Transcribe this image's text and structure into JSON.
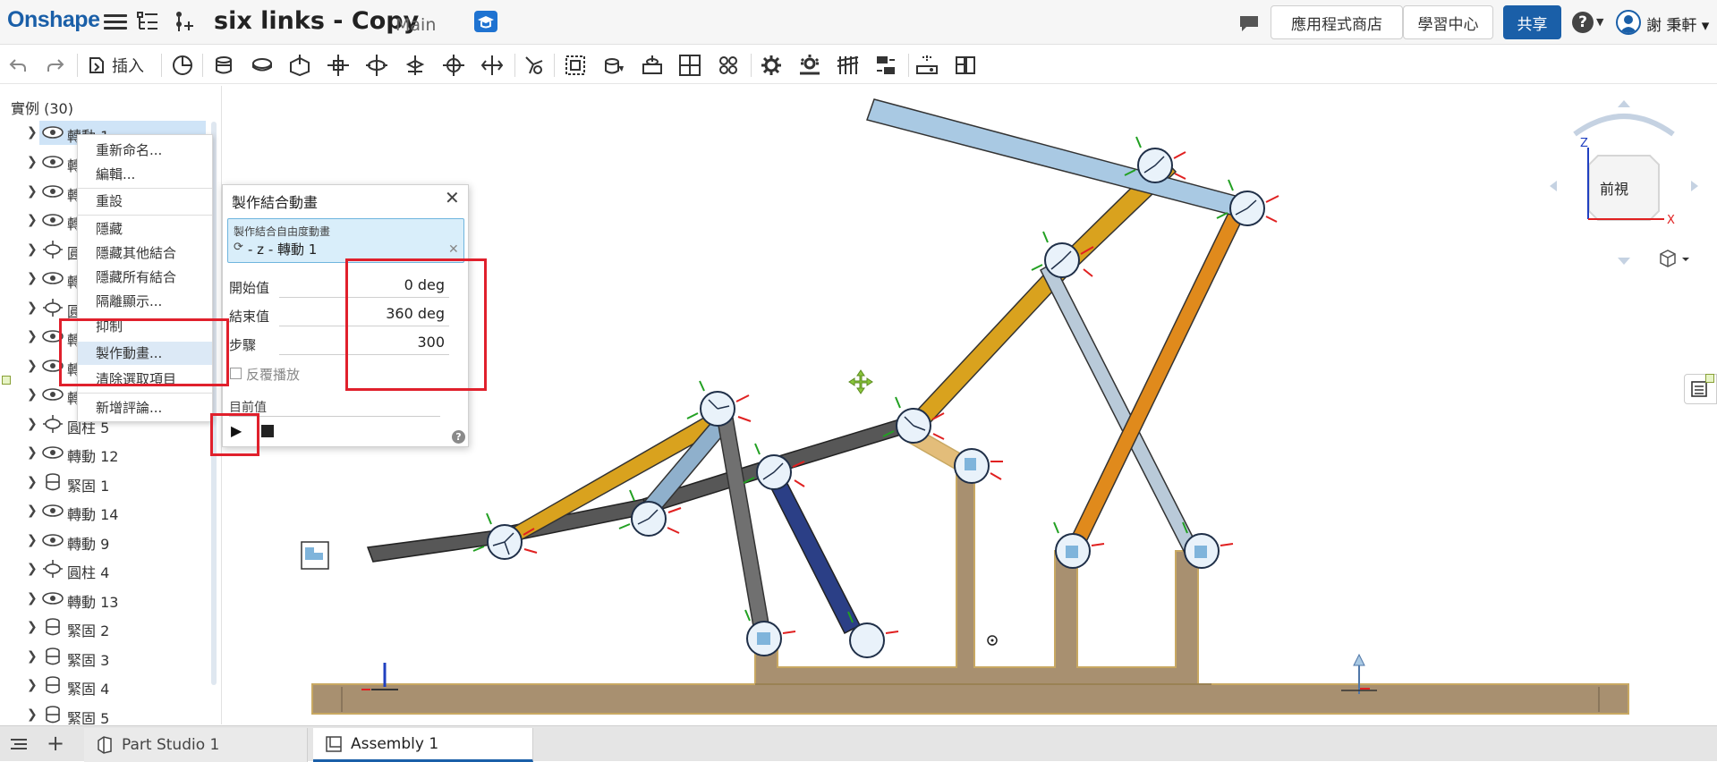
{
  "app": {
    "logo": "Onshape",
    "document_title": "six links - Copy",
    "branch": "Main",
    "app_store": "應用程式商店",
    "learning_center": "學習中心",
    "share": "共享",
    "help": "?",
    "username": "謝 秉軒"
  },
  "toolbar": {
    "insert_label": "插入",
    "icons": [
      "undo-icon",
      "redo-icon",
      "insert-icon",
      "mate-connector-icon",
      "fastened-mate-icon",
      "revolute-mate-icon",
      "slider-mate-icon",
      "planar-mate-icon",
      "cylindrical-mate-icon",
      "pin-slot-mate-icon",
      "ball-mate-icon",
      "parallel-mate-icon",
      "tangent-mate-icon",
      "group-icon",
      "replicate-icon",
      "mate-connector-2-icon",
      "relation-icon",
      "pattern-icon",
      "gear-relation-icon",
      "rack-pinion-icon",
      "screw-relation-icon",
      "linear-relation-icon",
      "explode-icon",
      "section-icon"
    ]
  },
  "instances": {
    "header": "實例 (30)",
    "items": [
      {
        "label": "轉動 1",
        "icon": "revolute-icon"
      },
      {
        "label": "轉",
        "icon": "revolute-icon"
      },
      {
        "label": "轉",
        "icon": "revolute-icon"
      },
      {
        "label": "轉",
        "icon": "revolute-icon"
      },
      {
        "label": "圓",
        "icon": "cylindrical-icon"
      },
      {
        "label": "轉",
        "icon": "revolute-icon"
      },
      {
        "label": "圓",
        "icon": "cylindrical-icon"
      },
      {
        "label": "轉",
        "icon": "revolute-icon"
      },
      {
        "label": "轉",
        "icon": "revolute-icon"
      },
      {
        "label": "轉",
        "icon": "revolute-icon"
      },
      {
        "label": "圓柱 5",
        "icon": "cylindrical-icon"
      },
      {
        "label": "轉動 12",
        "icon": "revolute-icon"
      },
      {
        "label": "緊固 1",
        "icon": "fastened-icon"
      },
      {
        "label": "轉動 14",
        "icon": "revolute-icon"
      },
      {
        "label": "轉動 9",
        "icon": "revolute-icon"
      },
      {
        "label": "圓柱 4",
        "icon": "cylindrical-icon"
      },
      {
        "label": "轉動 13",
        "icon": "revolute-icon"
      },
      {
        "label": "緊固 2",
        "icon": "fastened-icon"
      },
      {
        "label": "緊固 3",
        "icon": "fastened-icon"
      },
      {
        "label": "緊固 4",
        "icon": "fastened-icon"
      },
      {
        "label": "緊固 5",
        "icon": "fastened-icon"
      }
    ]
  },
  "context_menu": {
    "rename": "重新命名...",
    "edit": "編輯...",
    "reset": "重設",
    "hide": "隱藏",
    "hide_other_mates": "隱藏其他結合",
    "hide_all_mates": "隱藏所有結合",
    "isolate": "隔離顯示...",
    "suppress": "抑制",
    "animate": "製作動畫...",
    "clear_selection": "清除選取項目",
    "add_comment": "新增評論..."
  },
  "animate_dialog": {
    "title": "製作結合動畫",
    "dof_header": "製作結合自由度動畫",
    "dof_value": "- z - 轉動 1",
    "start_label": "開始值",
    "start_value": "0 deg",
    "end_label": "結束值",
    "end_value": "360 deg",
    "steps_label": "步驟",
    "steps_value": "300",
    "reverse_label": "反覆播放",
    "current_label": "目前值",
    "help": "?"
  },
  "view_cube": {
    "face_label": "前視",
    "axis_z": "Z",
    "axis_x": "X"
  },
  "bottom_tabs": [
    {
      "label": "Part Studio 1",
      "active": false
    },
    {
      "label": "Assembly 1",
      "active": true
    }
  ],
  "colors": {
    "brand": "#1a5fa8",
    "highlight_red": "#e0202c",
    "link_gold": "#d9a21e",
    "link_orange": "#e08a1c",
    "link_dark": "#575757",
    "link_blue": "#2b3f86",
    "link_lightblue": "#a9c9e3",
    "base": "#a89070"
  }
}
